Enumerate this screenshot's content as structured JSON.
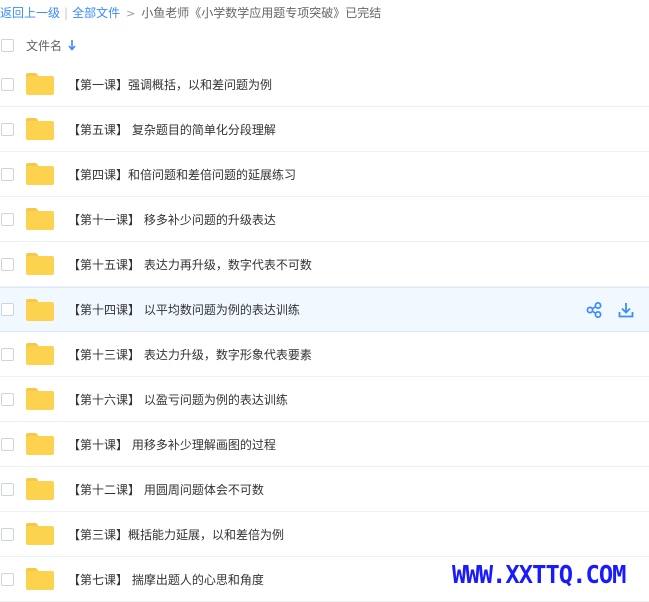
{
  "breadcrumb": {
    "back_label": "返回上一级",
    "all_files_label": "全部文件",
    "separator": "|",
    "arrow": ">",
    "current_path": "小鱼老师《小学数学应用题专项突破》已完结"
  },
  "list_header": {
    "column_label": "文件名",
    "sort_icon": "arrow-down-icon"
  },
  "files": [
    {
      "name": "【第一课】强调概括，以和差问题为例",
      "type": "folder"
    },
    {
      "name": "【第五课】 复杂题目的简单化分段理解",
      "type": "folder"
    },
    {
      "name": "【第四课】和倍问题和差倍问题的延展练习",
      "type": "folder"
    },
    {
      "name": "【第十一课】 移多补少问题的升级表达",
      "type": "folder"
    },
    {
      "name": "【第十五课】 表达力再升级，数字代表不可数",
      "type": "folder"
    },
    {
      "name": "【第十四课】 以平均数问题为例的表达训练",
      "type": "folder",
      "selected": true
    },
    {
      "name": "【第十三课】 表达力升级，数字形象代表要素",
      "type": "folder"
    },
    {
      "name": "【第十六课】 以盈亏问题为例的表达训练",
      "type": "folder"
    },
    {
      "name": "【第十课】 用移多补少理解画图的过程",
      "type": "folder"
    },
    {
      "name": "【第十二课】 用圆周问题体会不可数",
      "type": "folder"
    },
    {
      "name": "【第三课】概括能力延展，以和差倍为例",
      "type": "folder"
    },
    {
      "name": "【第七课】 揣摩出题人的心思和角度",
      "type": "folder"
    }
  ],
  "row_actions": {
    "share_icon": "share-icon",
    "download_icon": "download-icon"
  },
  "colors": {
    "accent": "#3b8cff",
    "folder": "#fdd24f",
    "selected_row": "#f1f8ff",
    "watermark": "#1a1aff"
  },
  "watermark": {
    "text": "WWW.XXTTQ.COM"
  }
}
